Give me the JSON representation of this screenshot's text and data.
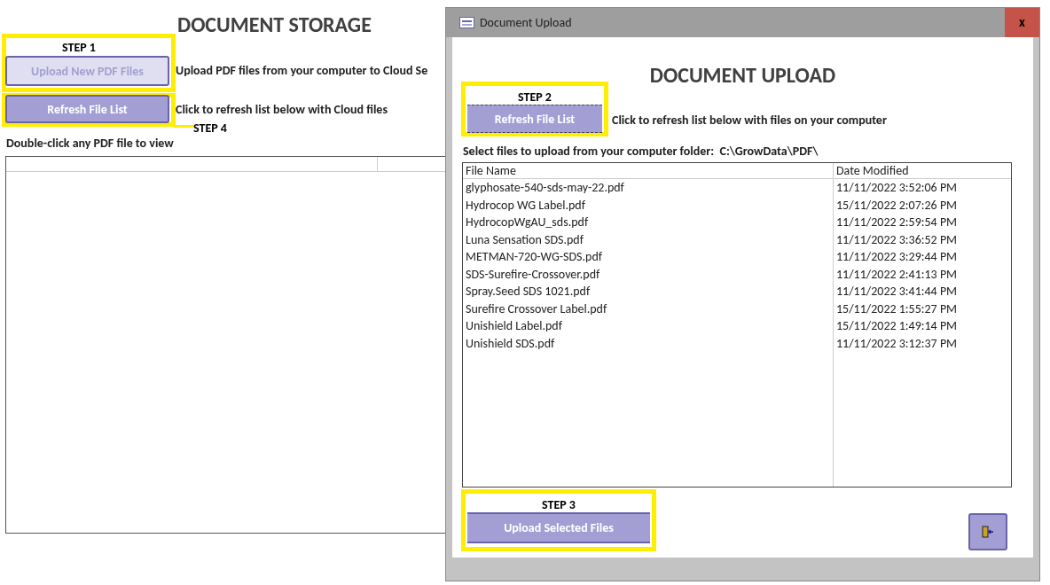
{
  "main": {
    "title": "DOCUMENT STORAGE",
    "steps": [
      {
        "label": "STEP 1",
        "button": "Upload New PDF Files",
        "disabled": true,
        "description": "Upload PDF files from your computer to Cloud Se"
      },
      {
        "label": "STEP 4",
        "button": "Refresh File List",
        "disabled": false,
        "description": "Click to refresh list below with Cloud files"
      }
    ],
    "list_hint": "Double-click any PDF file to view"
  },
  "dialog": {
    "window_title": "Document Upload",
    "close": "x",
    "title": "DOCUMENT UPLOAD",
    "step2": {
      "label": "STEP 2",
      "button": "Refresh File List",
      "description": "Click to refresh list below with files on your computer"
    },
    "folder_label": "Select files to upload from your computer folder:  C:\\GrowData\\PDF\\",
    "columns": [
      "File Name",
      "Date Modified"
    ],
    "rows": [
      [
        "glyphosate-540-sds-may-22.pdf",
        "11/11/2022 3:52:06 PM"
      ],
      [
        "Hydrocop WG Label.pdf",
        "15/11/2022 2:07:26 PM"
      ],
      [
        "HydrocopWgAU_sds.pdf",
        "11/11/2022 2:59:54 PM"
      ],
      [
        "Luna Sensation SDS.pdf",
        "11/11/2022 3:36:52 PM"
      ],
      [
        "METMAN-720-WG-SDS.pdf",
        "11/11/2022 3:29:44 PM"
      ],
      [
        "SDS-Surefire-Crossover.pdf",
        "11/11/2022 2:41:13 PM"
      ],
      [
        "Spray.Seed SDS 1021.pdf",
        "11/11/2022 3:41:44 PM"
      ],
      [
        "Surefire Crossover Label.pdf",
        "15/11/2022 1:55:27 PM"
      ],
      [
        "Unishield Label.pdf",
        "15/11/2022 1:49:14 PM"
      ],
      [
        "Unishield SDS.pdf",
        "11/11/2022 3:12:37 PM"
      ]
    ],
    "step3": {
      "label": "STEP 3",
      "button": "Upload Selected Files"
    }
  }
}
